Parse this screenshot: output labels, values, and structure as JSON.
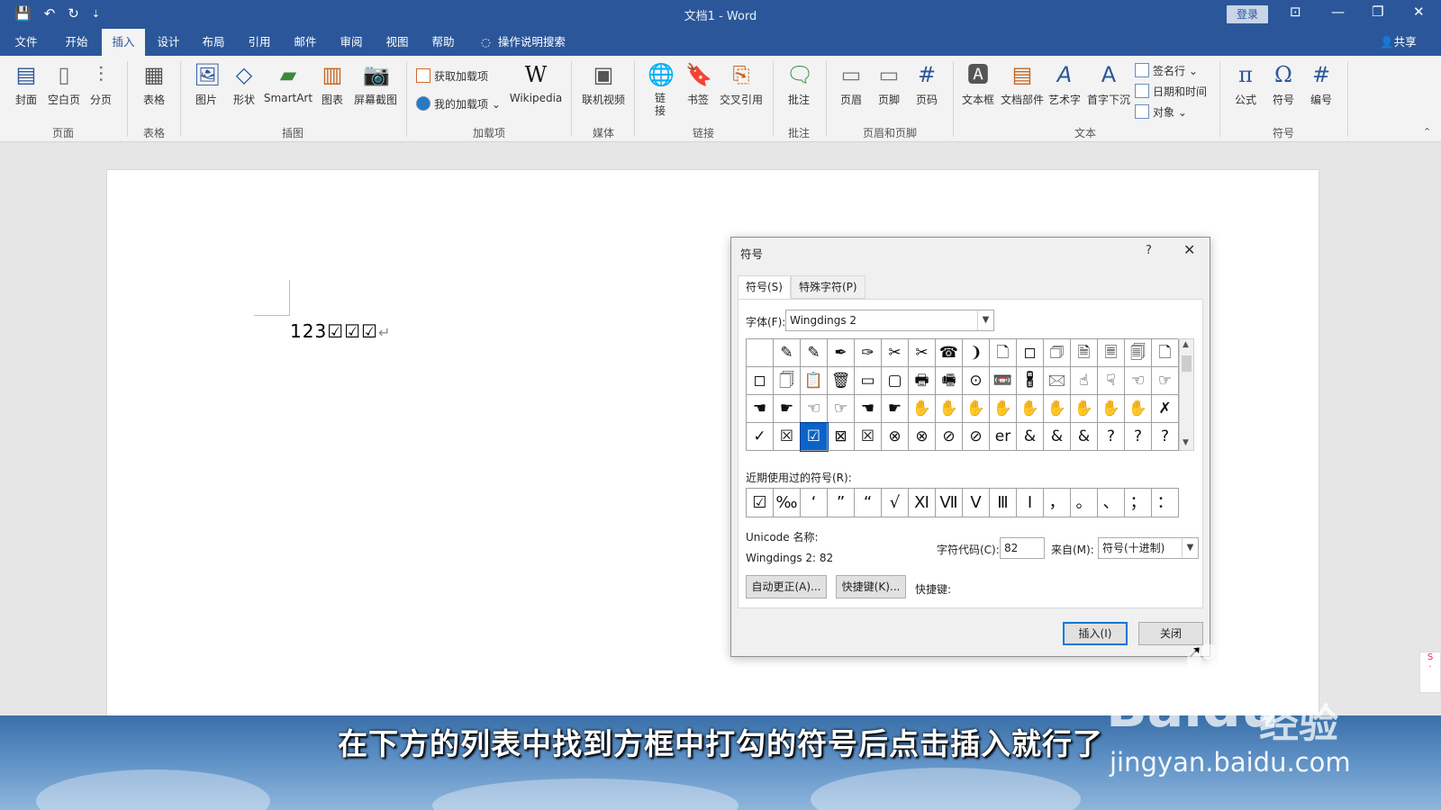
{
  "window": {
    "title": "文档1 - Word",
    "login_label": "登录",
    "qat": {
      "save": "💾",
      "undo": "↶",
      "redo": "↻",
      "more": "⇣"
    },
    "controls": {
      "ribbon_display": "⊡",
      "minimize": "—",
      "maximize": "❐",
      "close": "✕"
    }
  },
  "menu": {
    "tabs": [
      "文件",
      "开始",
      "插入",
      "设计",
      "布局",
      "引用",
      "邮件",
      "审阅",
      "视图",
      "帮助"
    ],
    "active": "插入",
    "tell_me": "操作说明搜索",
    "share": "共享"
  },
  "ribbon": {
    "pages": {
      "cover": "封面",
      "blank": "空白页",
      "break": "分页",
      "group": "页面"
    },
    "tables": {
      "table": "表格",
      "group": "表格"
    },
    "illustrations": {
      "picture": "图片",
      "shapes": "形状",
      "smartart": "SmartArt",
      "chart": "图表",
      "screenshot": "屏幕截图",
      "group": "插图"
    },
    "addins": {
      "get": "获取加载项",
      "mine": "我的加载项",
      "wikipedia": "Wikipedia",
      "group": "加载项"
    },
    "media": {
      "video": "联机视频",
      "group": "媒体"
    },
    "links": {
      "link": "链接",
      "bookmark": "书签",
      "crossref": "交叉引用",
      "group": "链接"
    },
    "comments": {
      "comment": "批注",
      "group": "批注"
    },
    "header_footer": {
      "header": "页眉",
      "footer": "页脚",
      "page_number": "页码",
      "group": "页眉和页脚"
    },
    "text": {
      "textbox": "文本框",
      "quickparts": "文档部件",
      "wordart": "艺术字",
      "dropcap": "首字下沉",
      "signature": "签名行",
      "datetime": "日期和时间",
      "object": "对象",
      "group": "文本"
    },
    "symbols": {
      "equation": "公式",
      "symbol": "符号",
      "number": "编号",
      "group": "符号"
    }
  },
  "document": {
    "text": "123☑☑☑",
    "pilcrow": "↵"
  },
  "dialog": {
    "title": "符号",
    "help": "?",
    "close": "✕",
    "tabs": [
      "符号(S)",
      "特殊字符(P)"
    ],
    "font_label": "字体(F):",
    "font_value": "Wingdings 2",
    "symbol_rows": [
      [
        "",
        "✎",
        "✎",
        "✒",
        "✑",
        "✂",
        "✂",
        "☎",
        "❩",
        "🗋",
        "◻",
        "🗇",
        "🗎",
        "🗏",
        "🗐",
        "🗋"
      ],
      [
        "◻",
        "🗍",
        "📋",
        "🗑",
        "▭",
        "▢",
        "🖶",
        "🖷",
        "⊙",
        "📼",
        "🖁",
        "🖂",
        "☝",
        "☟",
        "☜",
        "☞"
      ],
      [
        "☚",
        "☛",
        "☜",
        "☞",
        "☚",
        "☛",
        "✋",
        "✋",
        "✋",
        "✋",
        "✋",
        "✋",
        "✋",
        "✋",
        "✋",
        "✗"
      ],
      [
        "✓",
        "☒",
        "☑",
        "⊠",
        "☒",
        "⊗",
        "⊗",
        "⊘",
        "⊘",
        "er",
        "&",
        "&",
        "&",
        "?",
        "?",
        "?"
      ]
    ],
    "selected_index": 2,
    "recent_label": "近期使用过的符号(R):",
    "recent": [
      "☑",
      "‰",
      "‘",
      "”",
      "“",
      "√",
      "Ⅺ",
      "Ⅶ",
      "Ⅴ",
      "Ⅲ",
      "Ⅰ",
      "，",
      "。",
      "、",
      "；",
      "："
    ],
    "unicode_name_label": "Unicode 名称:",
    "unicode_name_value": "Wingdings 2: 82",
    "char_code_label": "字符代码(C):",
    "char_code_value": "82",
    "from_label": "来自(M):",
    "from_value": "符号(十进制)",
    "autocorrect": "自动更正(A)...",
    "shortcut_key_btn": "快捷键(K)...",
    "shortcut_label": "快捷键:",
    "insert": "插入(I)",
    "close_btn": "关闭"
  },
  "caption": {
    "text": "在下方的列表中找到方框中打勾的符号后点击插入就行了",
    "watermark": "Bai",
    "watermark_du": "du",
    "watermark_cn": "经验",
    "watermark_url": "jingyan.baidu.com"
  },
  "colors": {
    "word_blue": "#2b579a",
    "selection": "#0a64c8"
  }
}
